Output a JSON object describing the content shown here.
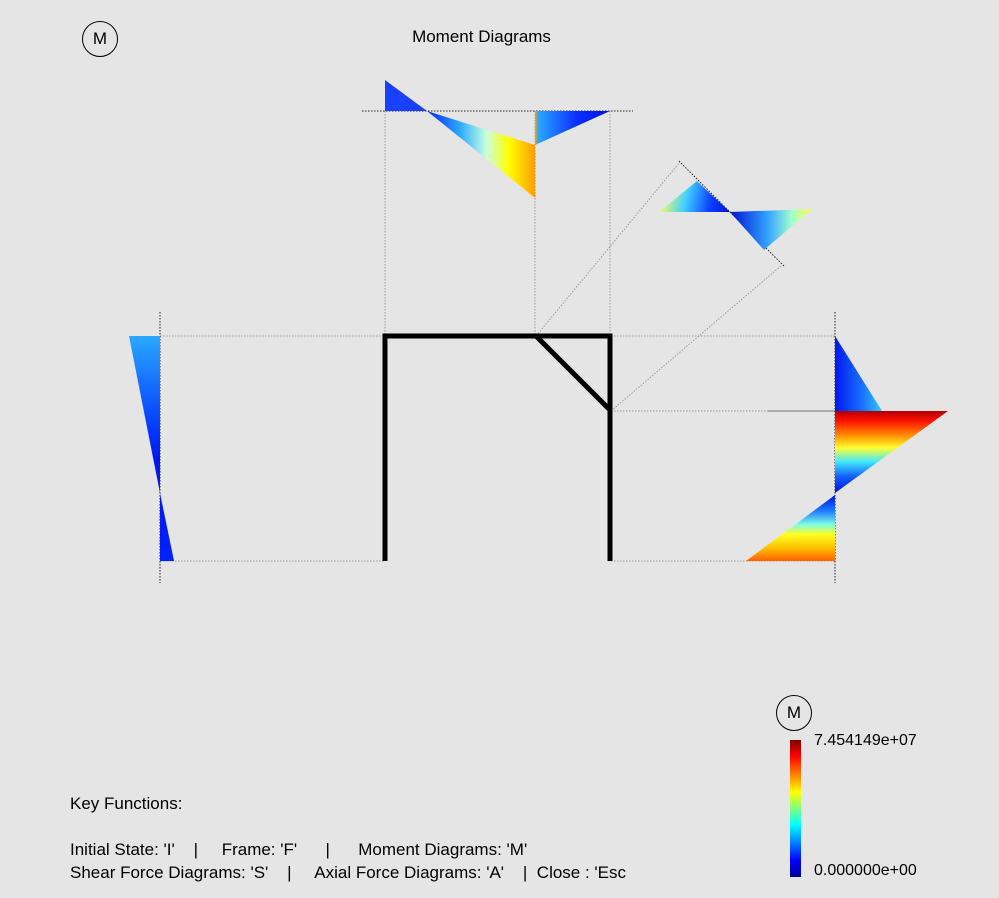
{
  "window": {
    "title": "Moment Diagrams",
    "mode_badge": "M"
  },
  "legend": {
    "badge": "M",
    "max_label": "7.454149e+07",
    "min_label": "0.000000e+00",
    "colormap": [
      "#00008f",
      "#0000ff",
      "#00ffff",
      "#ffff00",
      "#ff0000",
      "#800000"
    ]
  },
  "key_functions": {
    "heading": "Key Functions:",
    "line1": "Initial State: 'I'    |     Frame: 'F'      |      Moment Diagrams: 'M'",
    "line2": "Shear Force Diagrams: 'S'    |     Axial Force Diagrams: 'A'    |  Close : 'Esc"
  }
}
